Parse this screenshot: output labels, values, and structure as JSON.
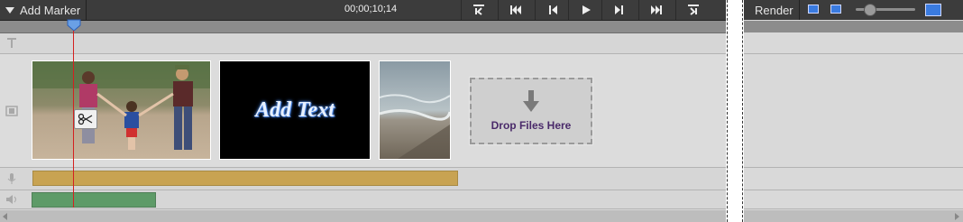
{
  "toolbar": {
    "add_marker_label": "Add Marker",
    "timecode": "00;00;10;14",
    "transport_buttons": [
      {
        "name": "set-in-button",
        "icon": "in-point-icon"
      },
      {
        "name": "go-to-start-button",
        "icon": "skip-back-icon"
      },
      {
        "name": "step-back-button",
        "icon": "step-back-icon"
      },
      {
        "name": "play-button",
        "icon": "play-icon"
      },
      {
        "name": "step-forward-button",
        "icon": "step-forward-icon"
      },
      {
        "name": "go-to-end-button",
        "icon": "skip-forward-icon"
      },
      {
        "name": "set-out-button",
        "icon": "out-point-icon"
      }
    ]
  },
  "timeline": {
    "tracks": [
      {
        "name": "text-track",
        "icon": "text-track-icon"
      },
      {
        "name": "video-track",
        "icon": "video-track-icon"
      },
      {
        "name": "narration-track",
        "icon": "microphone-icon"
      },
      {
        "name": "audio-track",
        "icon": "speaker-icon"
      }
    ],
    "clips": [
      {
        "name": "family-beach-clip"
      },
      {
        "name": "title-clip",
        "text": "Add Text"
      },
      {
        "name": "shore-clip"
      }
    ],
    "drop_zone_label": "Drop Files Here"
  },
  "render": {
    "label": "Render"
  },
  "colors": {
    "toolbar": "#3c3c3c",
    "playhead": "#d42020",
    "narration_bar": "#c8a352",
    "audio_bar": "#5e9b68",
    "accent_blue": "#3a7be0"
  }
}
